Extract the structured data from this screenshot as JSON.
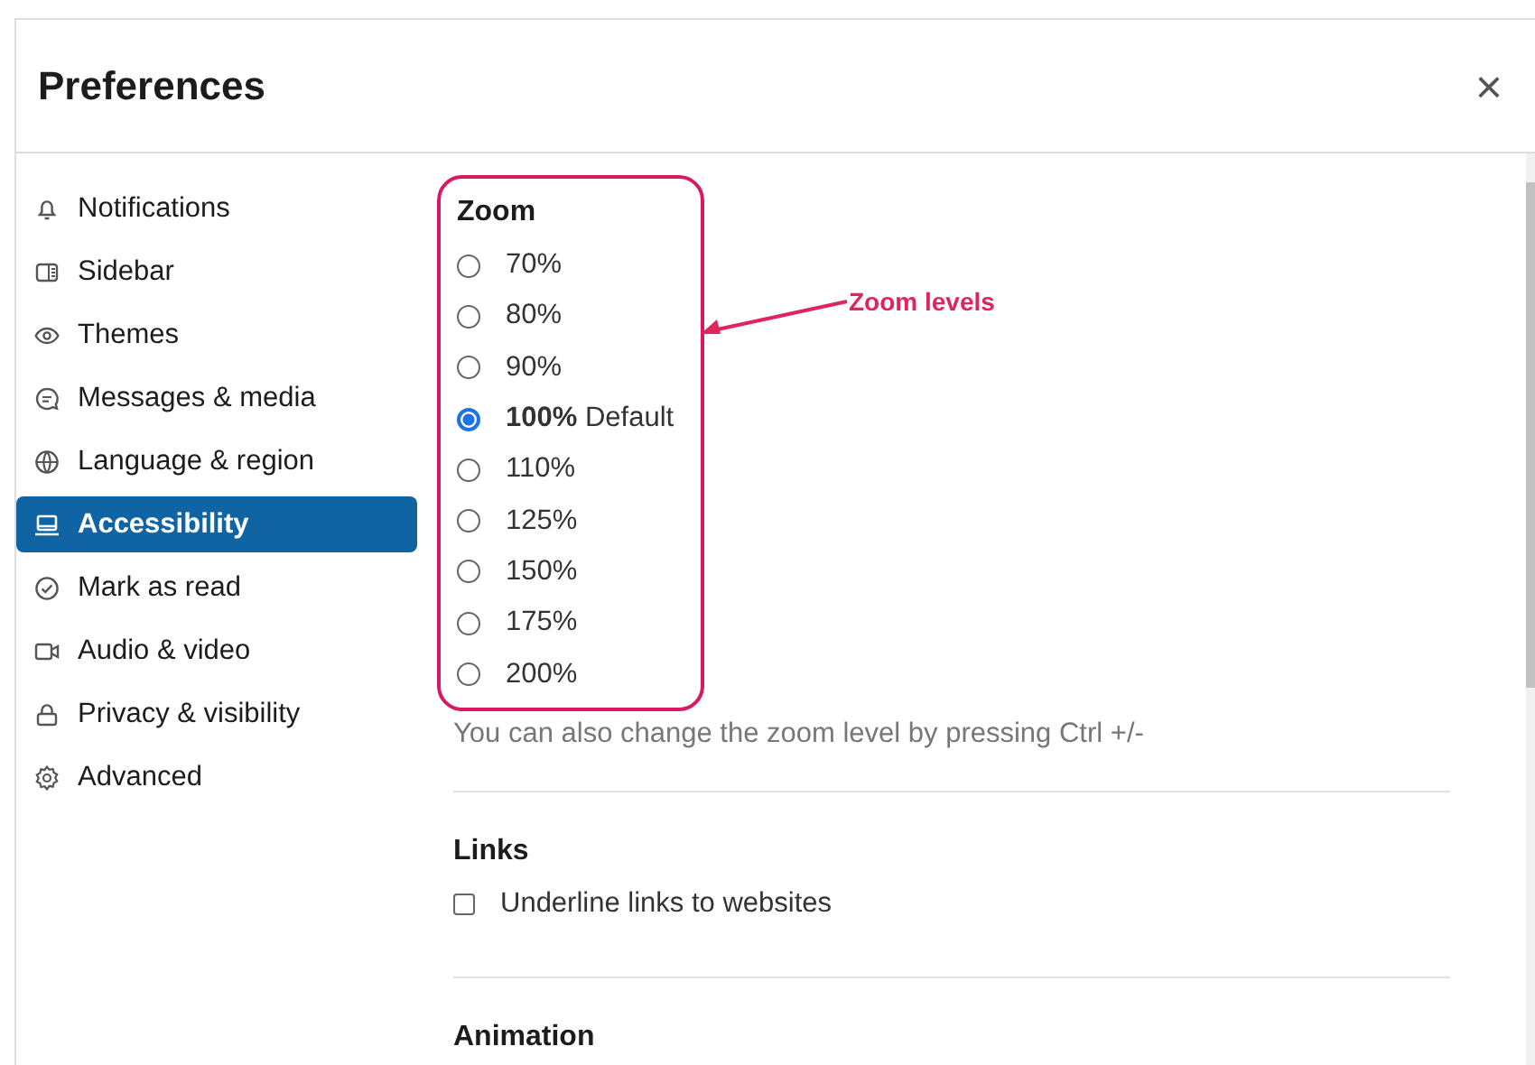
{
  "dialog": {
    "title": "Preferences",
    "close": "×"
  },
  "sidebar": {
    "items": [
      {
        "label": "Notifications",
        "selected": false
      },
      {
        "label": "Sidebar",
        "selected": false
      },
      {
        "label": "Themes",
        "selected": false
      },
      {
        "label": "Messages & media",
        "selected": false
      },
      {
        "label": "Language & region",
        "selected": false
      },
      {
        "label": "Accessibility",
        "selected": true
      },
      {
        "label": "Mark as read",
        "selected": false
      },
      {
        "label": "Audio & video",
        "selected": false
      },
      {
        "label": "Privacy & visibility",
        "selected": false
      },
      {
        "label": "Advanced",
        "selected": false
      }
    ]
  },
  "zoom": {
    "heading": "Zoom",
    "options": [
      {
        "label": "70%",
        "selected": false
      },
      {
        "label": "80%",
        "selected": false
      },
      {
        "label": "90%",
        "selected": false
      },
      {
        "label": "**100%** Default",
        "selected": true
      },
      {
        "label": "110%",
        "selected": false
      },
      {
        "label": "125%",
        "selected": false
      },
      {
        "label": "150%",
        "selected": false
      },
      {
        "label": "175%",
        "selected": false
      },
      {
        "label": "200%",
        "selected": false
      }
    ],
    "hint": "You can also change the zoom level by pressing Ctrl +/-"
  },
  "annotation": {
    "label": "Zoom levels"
  },
  "links": {
    "heading": "Links",
    "options": [
      {
        "label": "Underline links to websites",
        "checked": false
      }
    ]
  },
  "animation": {
    "heading": "Animation"
  }
}
